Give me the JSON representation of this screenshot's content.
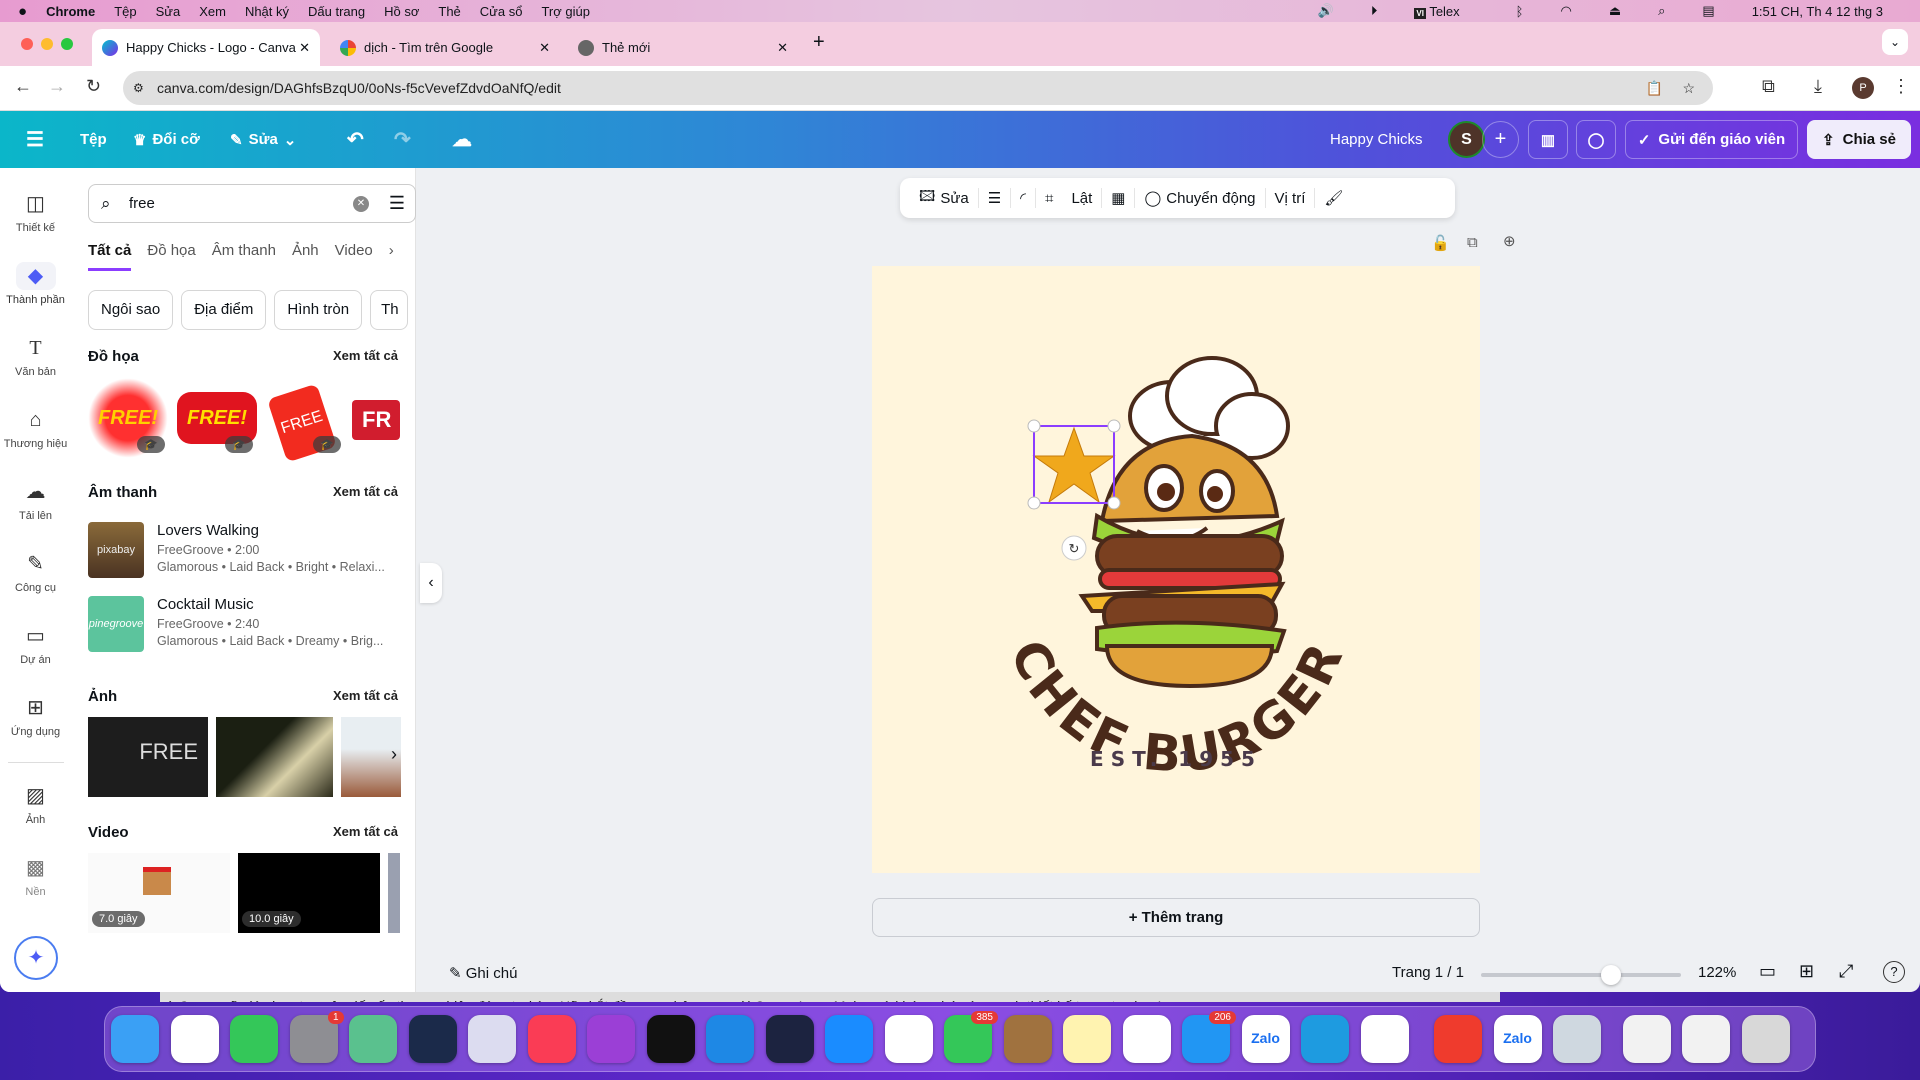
{
  "menubar": {
    "app": "Chrome",
    "items": [
      "Tệp",
      "Sửa",
      "Xem",
      "Nhật ký",
      "Dấu trang",
      "Hồ sơ",
      "Thẻ",
      "Cửa sổ",
      "Trợ giúp"
    ],
    "input_method": "Telex",
    "clock": "1:51 CH, Th 4 12 thg 3"
  },
  "browser": {
    "tabs": [
      {
        "title": "Happy Chicks - Logo - Canva"
      },
      {
        "title": "dịch - Tìm trên Google"
      },
      {
        "title": "Thẻ mới"
      }
    ],
    "url": "canva.com/design/DAGhfsBzqU0/0oNs-f5cVevefZdvdOaNfQ/edit",
    "profile": "P"
  },
  "header": {
    "file": "Tệp",
    "resize": "Đổi cỡ",
    "edit": "Sửa",
    "design_title": "Happy Chicks",
    "avatar": "S",
    "send_teacher": "Gửi đến giáo viên",
    "share": "Chia sẻ"
  },
  "rail": [
    {
      "label": "Thiết kế",
      "icon": "layout-icon"
    },
    {
      "label": "Thành phần",
      "icon": "elements-icon"
    },
    {
      "label": "Văn bản",
      "icon": "text-icon"
    },
    {
      "label": "Thương hiệu",
      "icon": "brand-icon"
    },
    {
      "label": "Tải lên",
      "icon": "upload-icon"
    },
    {
      "label": "Công cụ",
      "icon": "draw-icon"
    },
    {
      "label": "Dự án",
      "icon": "folder-icon"
    },
    {
      "label": "Ứng dụng",
      "icon": "apps-icon"
    },
    {
      "label": "Ảnh",
      "icon": "photo-icon"
    },
    {
      "label": "Nền",
      "icon": "background-icon"
    }
  ],
  "panel": {
    "search_value": "free",
    "tabs": [
      "Tất cả",
      "Đồ họa",
      "Âm thanh",
      "Ảnh",
      "Video"
    ],
    "chips": [
      "Ngôi sao",
      "Địa điểm",
      "Hình tròn",
      "Th"
    ],
    "see_all": "Xem tất cả",
    "graphics": {
      "title": "Đồ họa",
      "items": [
        "FREE!",
        "FREE!",
        "FREE",
        "FR"
      ]
    },
    "audio": {
      "title": "Âm thanh",
      "items": [
        {
          "title": "Lovers Walking",
          "meta": "FreeGroove • 2:00",
          "tags": "Glamorous • Laid Back • Bright • Relaxi...",
          "cover": "pixabay"
        },
        {
          "title": "Cocktail Music",
          "meta": "FreeGroove • 2:40",
          "tags": "Glamorous • Laid Back • Dreamy • Brig...",
          "cover": "pinegroove"
        }
      ]
    },
    "photos": {
      "title": "Ảnh",
      "first_text": "FREE"
    },
    "videos": {
      "title": "Video",
      "items": [
        {
          "duration": "7.0 giây"
        },
        {
          "duration": "10.0 giây"
        }
      ]
    }
  },
  "toolbar": {
    "edit": "Sửa",
    "flip": "Lật",
    "animate": "Chuyển động",
    "position": "Vị trí"
  },
  "design": {
    "brand_name": "CHEF BURGER",
    "established": "EST. 1955",
    "background": "#fff5dc",
    "text_color": "#4a2a1a"
  },
  "add_page": "+ Thêm trang",
  "footer": {
    "notes": "Ghi chú",
    "page_indicator": "Trang 1 / 1",
    "zoom": "122%",
    "zoom_fraction": 0.65
  },
  "behind_text": "và Canva sẽ giúp bạn tạo nên dấu ấn thương hiệu đáng tự hào. Hãy bắt đầu ngay hôm nay với Canva Logo Maker và khám phá sức mạnh thiết kế trong tay bạn!",
  "dock": [
    {
      "name": "Finder",
      "color": "#3aa0f5"
    },
    {
      "name": "Chrome",
      "color": "#ffffff"
    },
    {
      "name": "FaceTime",
      "color": "#34c759"
    },
    {
      "name": "System Settings",
      "color": "#8e8e93",
      "badge": "1"
    },
    {
      "name": "Maps",
      "color": "#5ac18e"
    },
    {
      "name": "Siri",
      "color": "#1b2a4a"
    },
    {
      "name": "Launchpad",
      "color": "#dcdcf0"
    },
    {
      "name": "Music",
      "color": "#fa3c55"
    },
    {
      "name": "Podcasts",
      "color": "#9b3fd6"
    },
    {
      "name": "TV",
      "color": "#111111"
    },
    {
      "name": "Safari",
      "color": "#1e88e5"
    },
    {
      "name": "Affinity",
      "color": "#1c2340"
    },
    {
      "name": "App Store",
      "color": "#1a8cff"
    },
    {
      "name": "Photos",
      "color": "#ffffff"
    },
    {
      "name": "Messages",
      "color": "#34c759",
      "badge": "385"
    },
    {
      "name": "Contacts",
      "color": "#a0723f"
    },
    {
      "name": "Notes",
      "color": "#fff3b0"
    },
    {
      "name": "Reminders",
      "color": "#ffffff"
    },
    {
      "name": "Mail",
      "color": "#2196f3",
      "badge": "206"
    },
    {
      "name": "Zalo",
      "color": "#ffffff"
    },
    {
      "name": "Skype",
      "color": "#1e9be0"
    },
    {
      "name": "Vector",
      "color": "#ffffff"
    },
    {
      "name": "AnyDesk",
      "color": "#ef3b2d"
    },
    {
      "name": "Zalo",
      "color": "#ffffff"
    },
    {
      "name": "Preview",
      "color": "#cfd8e0"
    },
    {
      "name": "Document",
      "color": "#f2f2f2"
    },
    {
      "name": "Document",
      "color": "#f2f2f2"
    },
    {
      "name": "Trash",
      "color": "#d8d8d8"
    }
  ]
}
